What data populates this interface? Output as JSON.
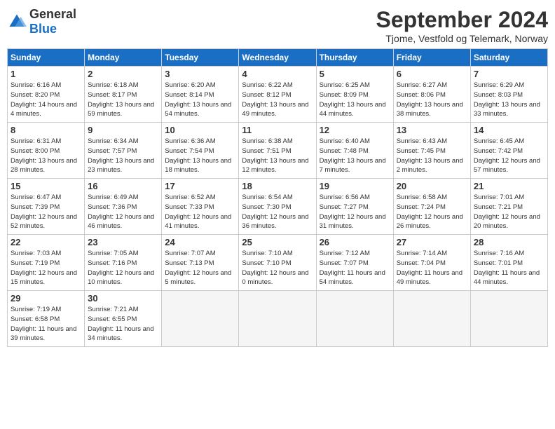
{
  "logo": {
    "general": "General",
    "blue": "Blue"
  },
  "header": {
    "month": "September 2024",
    "location": "Tjome, Vestfold og Telemark, Norway"
  },
  "days_of_week": [
    "Sunday",
    "Monday",
    "Tuesday",
    "Wednesday",
    "Thursday",
    "Friday",
    "Saturday"
  ],
  "weeks": [
    [
      {
        "day": "1",
        "sunrise": "6:16 AM",
        "sunset": "8:20 PM",
        "daylight": "14 hours and 4 minutes."
      },
      {
        "day": "2",
        "sunrise": "6:18 AM",
        "sunset": "8:17 PM",
        "daylight": "13 hours and 59 minutes."
      },
      {
        "day": "3",
        "sunrise": "6:20 AM",
        "sunset": "8:14 PM",
        "daylight": "13 hours and 54 minutes."
      },
      {
        "day": "4",
        "sunrise": "6:22 AM",
        "sunset": "8:12 PM",
        "daylight": "13 hours and 49 minutes."
      },
      {
        "day": "5",
        "sunrise": "6:25 AM",
        "sunset": "8:09 PM",
        "daylight": "13 hours and 44 minutes."
      },
      {
        "day": "6",
        "sunrise": "6:27 AM",
        "sunset": "8:06 PM",
        "daylight": "13 hours and 38 minutes."
      },
      {
        "day": "7",
        "sunrise": "6:29 AM",
        "sunset": "8:03 PM",
        "daylight": "13 hours and 33 minutes."
      }
    ],
    [
      {
        "day": "8",
        "sunrise": "6:31 AM",
        "sunset": "8:00 PM",
        "daylight": "13 hours and 28 minutes."
      },
      {
        "day": "9",
        "sunrise": "6:34 AM",
        "sunset": "7:57 PM",
        "daylight": "13 hours and 23 minutes."
      },
      {
        "day": "10",
        "sunrise": "6:36 AM",
        "sunset": "7:54 PM",
        "daylight": "13 hours and 18 minutes."
      },
      {
        "day": "11",
        "sunrise": "6:38 AM",
        "sunset": "7:51 PM",
        "daylight": "13 hours and 12 minutes."
      },
      {
        "day": "12",
        "sunrise": "6:40 AM",
        "sunset": "7:48 PM",
        "daylight": "13 hours and 7 minutes."
      },
      {
        "day": "13",
        "sunrise": "6:43 AM",
        "sunset": "7:45 PM",
        "daylight": "13 hours and 2 minutes."
      },
      {
        "day": "14",
        "sunrise": "6:45 AM",
        "sunset": "7:42 PM",
        "daylight": "12 hours and 57 minutes."
      }
    ],
    [
      {
        "day": "15",
        "sunrise": "6:47 AM",
        "sunset": "7:39 PM",
        "daylight": "12 hours and 52 minutes."
      },
      {
        "day": "16",
        "sunrise": "6:49 AM",
        "sunset": "7:36 PM",
        "daylight": "12 hours and 46 minutes."
      },
      {
        "day": "17",
        "sunrise": "6:52 AM",
        "sunset": "7:33 PM",
        "daylight": "12 hours and 41 minutes."
      },
      {
        "day": "18",
        "sunrise": "6:54 AM",
        "sunset": "7:30 PM",
        "daylight": "12 hours and 36 minutes."
      },
      {
        "day": "19",
        "sunrise": "6:56 AM",
        "sunset": "7:27 PM",
        "daylight": "12 hours and 31 minutes."
      },
      {
        "day": "20",
        "sunrise": "6:58 AM",
        "sunset": "7:24 PM",
        "daylight": "12 hours and 26 minutes."
      },
      {
        "day": "21",
        "sunrise": "7:01 AM",
        "sunset": "7:21 PM",
        "daylight": "12 hours and 20 minutes."
      }
    ],
    [
      {
        "day": "22",
        "sunrise": "7:03 AM",
        "sunset": "7:19 PM",
        "daylight": "12 hours and 15 minutes."
      },
      {
        "day": "23",
        "sunrise": "7:05 AM",
        "sunset": "7:16 PM",
        "daylight": "12 hours and 10 minutes."
      },
      {
        "day": "24",
        "sunrise": "7:07 AM",
        "sunset": "7:13 PM",
        "daylight": "12 hours and 5 minutes."
      },
      {
        "day": "25",
        "sunrise": "7:10 AM",
        "sunset": "7:10 PM",
        "daylight": "12 hours and 0 minutes."
      },
      {
        "day": "26",
        "sunrise": "7:12 AM",
        "sunset": "7:07 PM",
        "daylight": "11 hours and 54 minutes."
      },
      {
        "day": "27",
        "sunrise": "7:14 AM",
        "sunset": "7:04 PM",
        "daylight": "11 hours and 49 minutes."
      },
      {
        "day": "28",
        "sunrise": "7:16 AM",
        "sunset": "7:01 PM",
        "daylight": "11 hours and 44 minutes."
      }
    ],
    [
      {
        "day": "29",
        "sunrise": "7:19 AM",
        "sunset": "6:58 PM",
        "daylight": "11 hours and 39 minutes."
      },
      {
        "day": "30",
        "sunrise": "7:21 AM",
        "sunset": "6:55 PM",
        "daylight": "11 hours and 34 minutes."
      },
      null,
      null,
      null,
      null,
      null
    ]
  ],
  "labels": {
    "sunrise": "Sunrise:",
    "sunset": "Sunset:",
    "daylight": "Daylight:"
  }
}
